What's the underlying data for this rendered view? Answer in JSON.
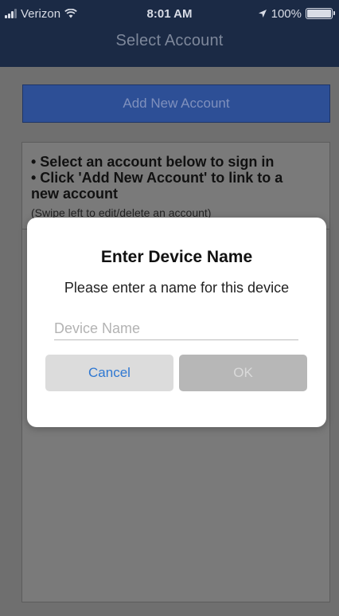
{
  "status_bar": {
    "carrier": "Verizon",
    "time": "8:01 AM",
    "battery": "100%",
    "battery_level": 1.0,
    "icons": [
      "signal-icon",
      "wifi-icon",
      "location-icon",
      "battery-icon"
    ]
  },
  "nav": {
    "title": "Select Account"
  },
  "add_account": {
    "label": "Add New Account"
  },
  "instructions": {
    "line1": "• Select an account below to sign in",
    "line2": "• Click 'Add New Account' to link to a",
    "line3": "new account",
    "note": "(Swipe left to edit/delete an account)"
  },
  "dialog": {
    "title": "Enter Device Name",
    "message": "Please enter a name for this device",
    "input_value": "",
    "input_placeholder": "Device Name",
    "cancel_label": "Cancel",
    "ok_label": "OK"
  },
  "colors": {
    "nav_background": "#1b2a45",
    "add_button": "#2d4f96",
    "cancel_text": "#2f78d2"
  }
}
